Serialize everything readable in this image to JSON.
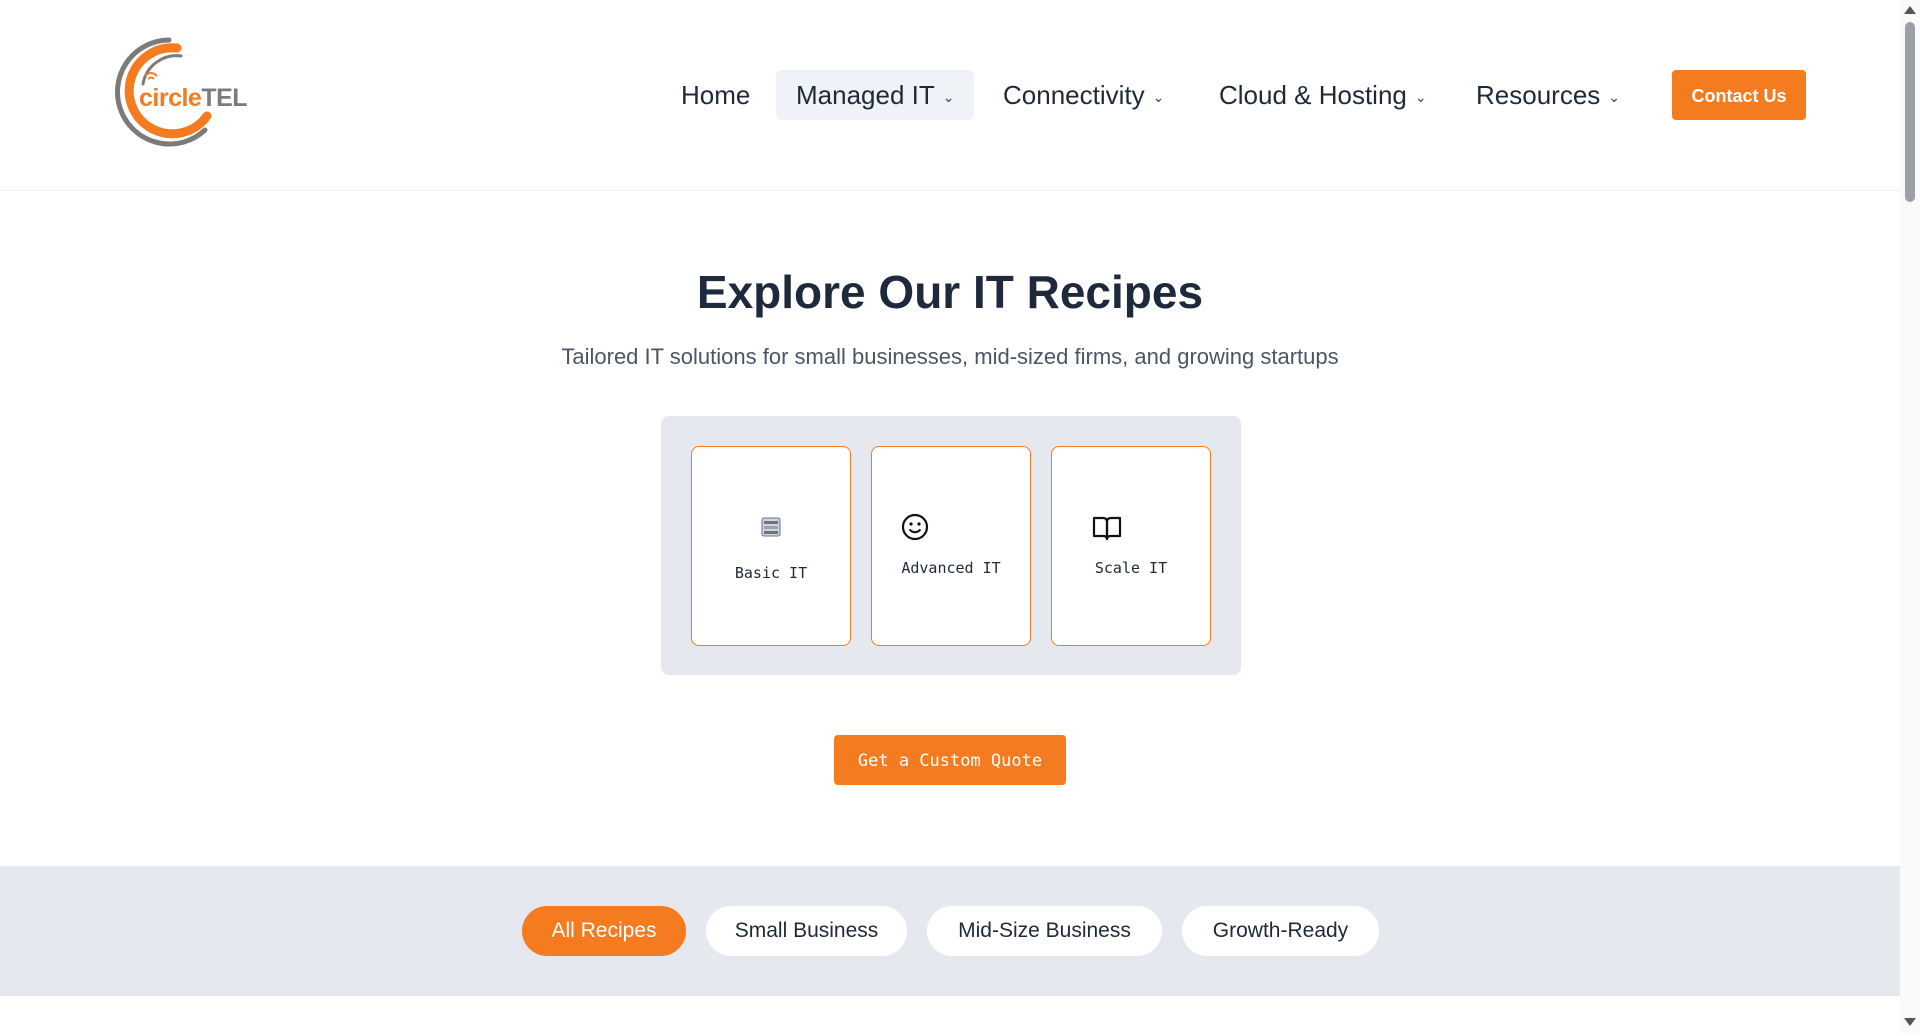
{
  "brand": {
    "logo_text_circle": "circle",
    "logo_text_tel": "TEL",
    "accent_color": "#f47b20"
  },
  "nav": {
    "items": [
      {
        "label": "Home",
        "has_dropdown": false
      },
      {
        "label": "Managed IT",
        "has_dropdown": true,
        "active": true
      },
      {
        "label": "Connectivity",
        "has_dropdown": true
      },
      {
        "label": "Cloud & Hosting",
        "has_dropdown": true
      },
      {
        "label": "Resources",
        "has_dropdown": true
      }
    ],
    "contact_label": "Contact Us"
  },
  "hero": {
    "title": "Explore Our IT Recipes",
    "subtitle": "Tailored IT solutions for small businesses, mid-sized firms, and growing startups"
  },
  "cards": [
    {
      "label": "Basic IT",
      "icon": "server-icon"
    },
    {
      "label": "Advanced IT",
      "icon": "smile-icon"
    },
    {
      "label": "Scale IT",
      "icon": "book-open-icon"
    }
  ],
  "quote_button": "Get a Custom Quote",
  "filters": [
    {
      "label": "All Recipes",
      "active": true
    },
    {
      "label": "Small Business"
    },
    {
      "label": "Mid-Size Business"
    },
    {
      "label": "Growth-Ready"
    }
  ]
}
